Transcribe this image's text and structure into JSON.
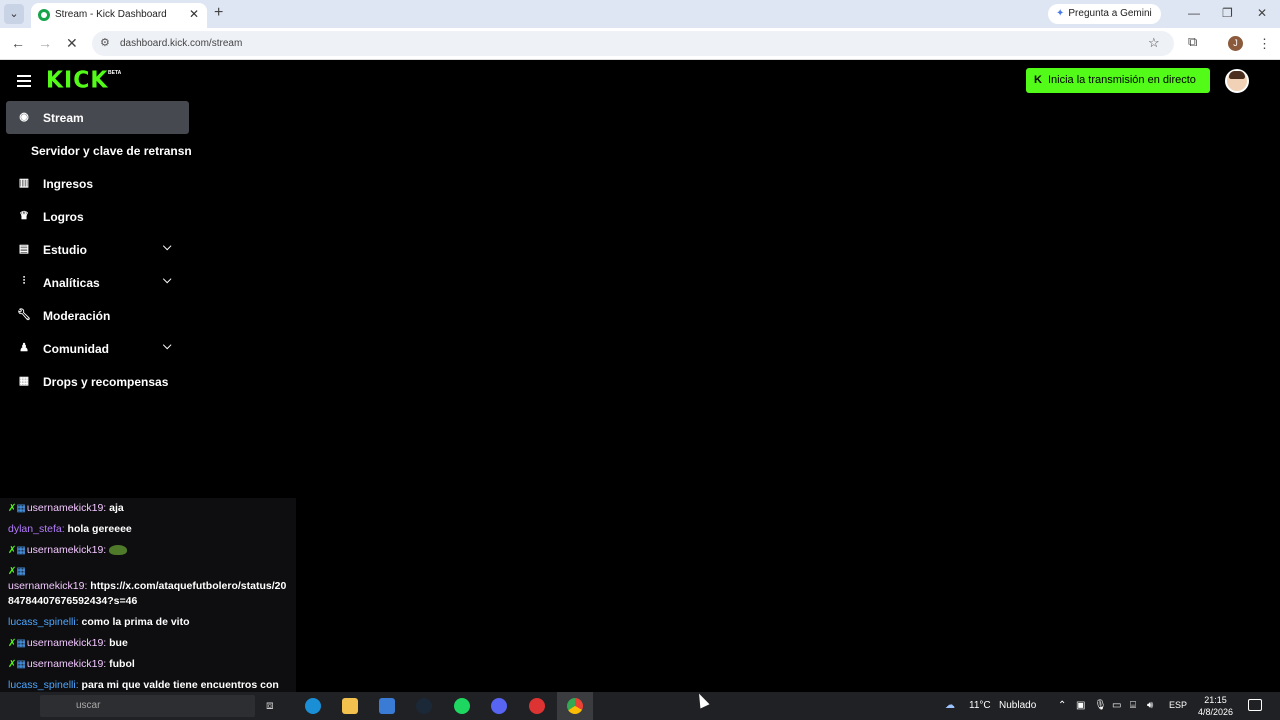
{
  "browser": {
    "tab_title": "Stream - Kick Dashboard",
    "tab_close": "✕",
    "new_tab": "+",
    "gemini_label": "Pregunta a Gemini",
    "url": "dashboard.kick.com/stream",
    "profile_initial": "J",
    "window_controls": [
      "—",
      "❐",
      "✕"
    ]
  },
  "header": {
    "logo": "KICK",
    "logo_badge": "BETA",
    "live_button_icon": "K",
    "live_button_label": "Inicia la transmisión en directo"
  },
  "sidebar": {
    "items": [
      {
        "label": "Stream",
        "icon": "broadcast-icon",
        "active": true
      },
      {
        "label": "Servidor y clave de retransn",
        "sub": true
      },
      {
        "label": "Ingresos",
        "icon": "bar-chart-icon"
      },
      {
        "label": "Logros",
        "icon": "trophy-icon"
      },
      {
        "label": "Estudio",
        "icon": "film-icon",
        "expandable": true
      },
      {
        "label": "Analíticas",
        "icon": "analytics-icon",
        "expandable": true
      },
      {
        "label": "Moderación",
        "icon": "wrench-icon"
      },
      {
        "label": "Comunidad",
        "icon": "users-icon",
        "expandable": true
      },
      {
        "label": "Drops y recompensas",
        "icon": "gift-icon"
      }
    ]
  },
  "chat": {
    "messages": [
      {
        "user": "usernamekick19:",
        "text": "aja"
      },
      {
        "user": "dylan_stefa:",
        "text": "hola gereeee"
      },
      {
        "user": "usernamekick19:",
        "text": ""
      },
      {
        "user": "usernamekick19:",
        "text": "https://x.com/ataquefutbolero/status/2084784407676592434?s=46"
      },
      {
        "user": "lucass_spinelli:",
        "text": "como la prima de vito"
      },
      {
        "user": "usernamekick19:",
        "text": "bue"
      },
      {
        "user": "usernamekick19:",
        "text": "fubol"
      },
      {
        "user": "lucass_spinelli:",
        "text": "para mi que valde tiene encuentros con la prima"
      }
    ]
  },
  "taskbar": {
    "search_placeholder": "uscar",
    "weather_temp": "11°C",
    "weather_desc": "Nublado",
    "lang": "ESP",
    "time": "21:15",
    "date": "4/8/2026"
  }
}
